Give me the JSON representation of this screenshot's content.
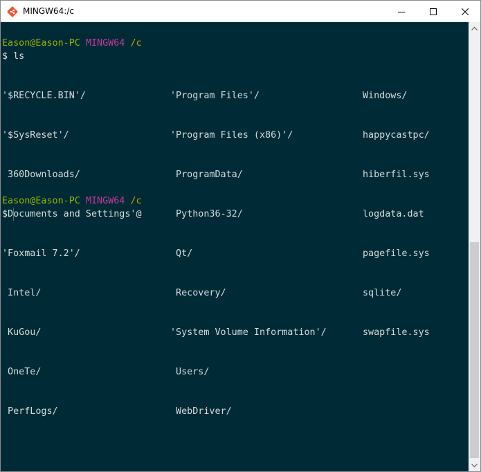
{
  "window": {
    "title": "MINGW64:/c"
  },
  "session": {
    "prompt1": {
      "user_host": "Eason@Eason-PC",
      "shell": "MINGW64",
      "cwd": "/c"
    },
    "command_line": "$ ls",
    "columns": [
      [
        "'$RECYCLE.BIN'/",
        "'$SysReset'/",
        " 360Downloads/",
        "'Documents and Settings'@",
        "'Foxmail 7.2'/",
        " Intel/",
        " KuGou/",
        " OneTe/",
        " PerfLogs/"
      ],
      [
        "'Program Files'/",
        "'Program Files (x86)'/",
        " ProgramData/",
        " Python36-32/",
        " Qt/",
        " Recovery/",
        "'System Volume Information'/",
        " Users/",
        " WebDriver/"
      ],
      [
        "Windows/",
        "happycastpc/",
        "hiberfil.sys",
        "logdata.dat",
        "pagefile.sys",
        "sqlite/",
        "swapfile.sys"
      ]
    ],
    "prompt2": {
      "user_host": "Eason@Eason-PC",
      "shell": "MINGW64",
      "cwd": "/c"
    },
    "prompt_symbol": "$"
  },
  "colors": {
    "background": "#002b36",
    "user": "#98b300",
    "host": "#c9379a",
    "path": "#c9a300",
    "text": "#d3dcdc"
  },
  "icons": {
    "app": "git-bash-icon",
    "minimize": "minimize-icon",
    "maximize": "maximize-icon",
    "close": "close-icon"
  }
}
